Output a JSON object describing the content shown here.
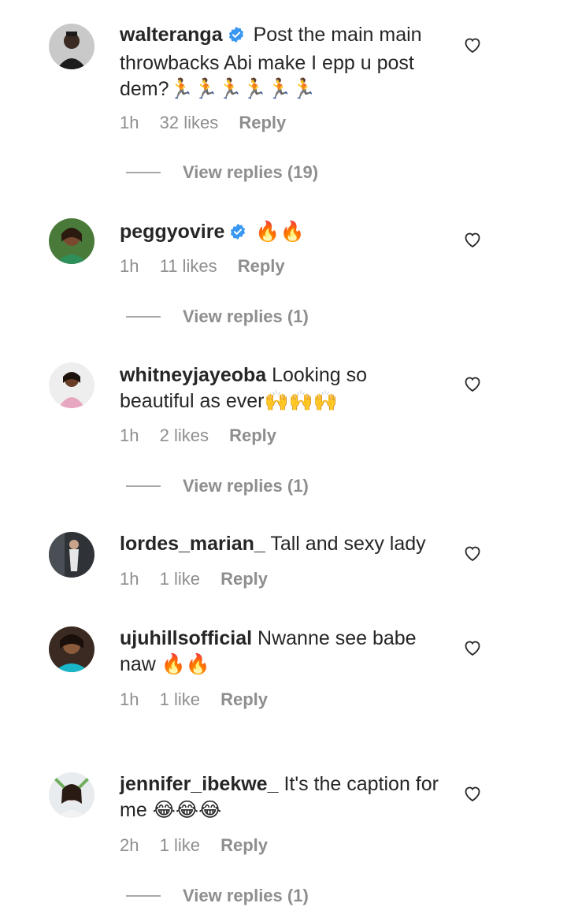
{
  "colors": {
    "text": "#262626",
    "muted": "#8e8e8e",
    "verified": "#3897f0"
  },
  "comments": [
    {
      "username": "walteranga",
      "verified": true,
      "text": "Post the main main throwbacks Abi make I epp u post dem?🏃🏃🏃🏃🏃🏃",
      "time": "1h",
      "likes": "32 likes",
      "reply": "Reply",
      "view_replies": "View replies (19)"
    },
    {
      "username": "peggyovire",
      "verified": true,
      "text": "🔥🔥",
      "time": "1h",
      "likes": "11 likes",
      "reply": "Reply",
      "view_replies": "View replies (1)"
    },
    {
      "username": "whitneyjayeoba",
      "verified": false,
      "text": "Looking so beautiful as ever🙌🙌🙌",
      "time": "1h",
      "likes": "2 likes",
      "reply": "Reply",
      "view_replies": "View replies (1)"
    },
    {
      "username": "lordes_marian_",
      "verified": false,
      "text": "Tall and sexy lady",
      "time": "1h",
      "likes": "1 like",
      "reply": "Reply"
    },
    {
      "username": "ujuhillsofficial",
      "verified": false,
      "text": "Nwanne see babe naw 🔥🔥",
      "time": "1h",
      "likes": "1 like",
      "reply": "Reply"
    },
    {
      "username": "jennifer_ibekwe_",
      "verified": false,
      "text": "It's the caption for me 😂😂😂",
      "time": "2h",
      "likes": "1 like",
      "reply": "Reply",
      "view_replies": "View replies (1)"
    }
  ]
}
